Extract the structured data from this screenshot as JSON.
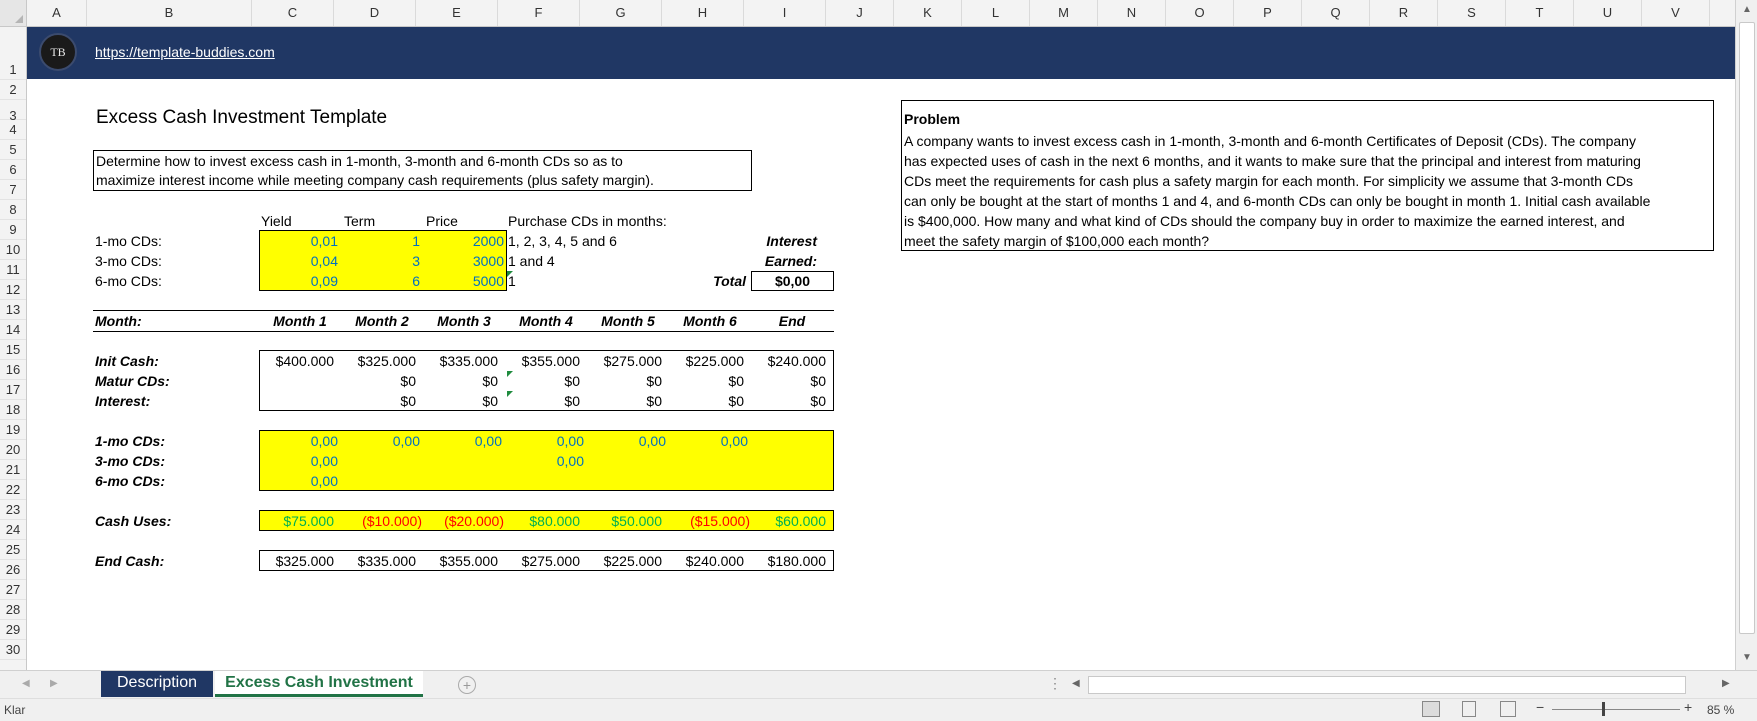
{
  "columns": [
    "A",
    "B",
    "C",
    "D",
    "E",
    "F",
    "G",
    "H",
    "I",
    "J",
    "K",
    "L",
    "M",
    "N",
    "O",
    "P",
    "Q",
    "R",
    "S",
    "T",
    "U",
    "V"
  ],
  "rows": [
    "1",
    "2",
    "3",
    "4",
    "5",
    "6",
    "7",
    "8",
    "9",
    "10",
    "11",
    "12",
    "13",
    "14",
    "15",
    "16",
    "17",
    "18",
    "19",
    "20",
    "21",
    "22",
    "23",
    "24",
    "25",
    "26",
    "27",
    "28",
    "29",
    "30"
  ],
  "banner": {
    "logo_text": "TB",
    "link": "https://template-buddies.com"
  },
  "title": "Excess Cash Investment Template",
  "description_lines": [
    "Determine how to invest excess cash in 1-month, 3-month and 6-month CDs so as to",
    "maximize interest income while meeting company cash requirements (plus safety margin)."
  ],
  "cd_table": {
    "headers": {
      "yield": "Yield",
      "term": "Term",
      "price": "Price",
      "purchase": "Purchase CDs in months:"
    },
    "rows": [
      {
        "label": "1-mo CDs:",
        "yield": "0,01",
        "term": "1",
        "price": "2000",
        "months": "1, 2, 3, 4, 5 and 6"
      },
      {
        "label": "3-mo CDs:",
        "yield": "0,04",
        "term": "3",
        "price": "3000",
        "months": "1 and 4"
      },
      {
        "label": "6-mo CDs:",
        "yield": "0,09",
        "term": "6",
        "price": "5000",
        "months": "1"
      }
    ],
    "interest_label_1": "Interest",
    "interest_label_2": "Earned:",
    "total_label": "Total",
    "total_value": "$0,00"
  },
  "months": {
    "label": "Month:",
    "headers": [
      "Month 1",
      "Month 2",
      "Month 3",
      "Month 4",
      "Month 5",
      "Month 6",
      "End"
    ]
  },
  "cash": {
    "init_label": "Init Cash:",
    "init": [
      "$400.000",
      "$325.000",
      "$335.000",
      "$355.000",
      "$275.000",
      "$225.000",
      "$240.000"
    ],
    "matur_label": "Matur CDs:",
    "matur": [
      "",
      "$0",
      "$0",
      "$0",
      "$0",
      "$0",
      "$0"
    ],
    "interest_label": "Interest:",
    "interest": [
      "",
      "$0",
      "$0",
      "$0",
      "$0",
      "$0",
      "$0"
    ]
  },
  "purchases": {
    "one_label": "1-mo CDs:",
    "one": [
      "0,00",
      "0,00",
      "0,00",
      "0,00",
      "0,00",
      "0,00"
    ],
    "three_label": "3-mo CDs:",
    "three": [
      "0,00",
      "0,00"
    ],
    "six_label": "6-mo CDs:",
    "six": [
      "0,00"
    ]
  },
  "cash_uses": {
    "label": "Cash Uses:",
    "values": [
      "$75.000",
      "($10.000)",
      "($20.000)",
      "$80.000",
      "$50.000",
      "($15.000)",
      "$60.000"
    ]
  },
  "end_cash": {
    "label": "End Cash:",
    "values": [
      "$325.000",
      "$335.000",
      "$355.000",
      "$275.000",
      "$225.000",
      "$240.000",
      "$180.000"
    ]
  },
  "problem": {
    "heading": "Problem",
    "lines": [
      "A company wants to invest excess cash in 1-month, 3-month and 6-month Certificates of Deposit (CDs).  The company",
      "has expected uses of cash in the next 6 months, and it wants to make sure that the principal and interest from maturing",
      "CDs meet the requirements for cash plus a safety margin for each month. For simplicity we assume that 3-month CDs",
      "can only be bought at the start of months 1 and 4, and 6-month CDs can only be bought in month 1. Initial cash available",
      "is $400,000.  How many and what kind of CDs should the company buy in order to maximize the earned interest, and",
      "meet the safety margin of $100,000 each month?"
    ]
  },
  "tabs": {
    "tab1": "Description",
    "tab2": "Excess Cash Investment"
  },
  "status": {
    "ready": "Klar",
    "zoom": "85 %"
  },
  "colors": {
    "banner": "#203764",
    "input_fill": "#ffff00",
    "input_text": "#0070c0",
    "positive_use": "#00b050",
    "negative_use": "#ff0000",
    "active_tab": "#217346"
  }
}
